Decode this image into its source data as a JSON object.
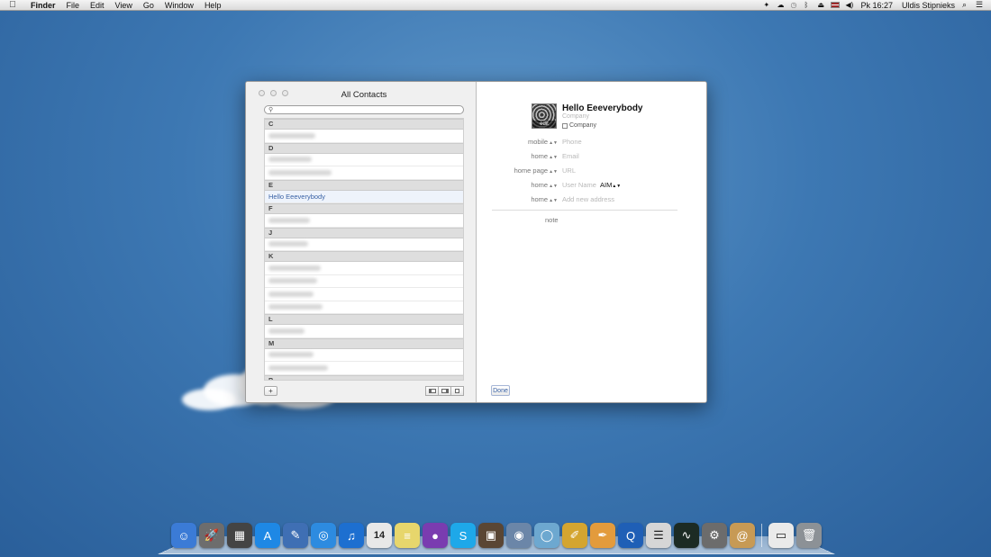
{
  "menubar": {
    "app_name": "Finder",
    "items": [
      "File",
      "Edit",
      "View",
      "Go",
      "Window",
      "Help"
    ],
    "clock": "Pk 16:27",
    "user": "Uldis Stipnieks"
  },
  "window": {
    "title": "All Contacts",
    "sections": [
      {
        "letter": "C",
        "rows": 1
      },
      {
        "letter": "D",
        "rows": 2
      },
      {
        "letter": "E",
        "rows": 0
      },
      {
        "letter": "F",
        "rows": 1
      },
      {
        "letter": "J",
        "rows": 1
      },
      {
        "letter": "K",
        "rows": 4
      },
      {
        "letter": "L",
        "rows": 1
      },
      {
        "letter": "M",
        "rows": 2
      },
      {
        "letter": "P",
        "rows": 0
      }
    ],
    "selected_contact": "Hello Eeeverybody",
    "add_button": "+",
    "card": {
      "name": "Hello Eeeverybody",
      "company_placeholder": "Company",
      "company_checkbox_label": "Company",
      "avatar_edit_label": "edit",
      "fields": [
        {
          "label": "mobile",
          "value": "Phone"
        },
        {
          "label": "home",
          "value": "Email"
        },
        {
          "label": "home page",
          "value": "URL"
        },
        {
          "label": "home",
          "value": "User Name"
        },
        {
          "label": "home",
          "value": "Add new address"
        }
      ],
      "aim_label": "AIM",
      "note_label": "note",
      "done_button": "Done"
    }
  },
  "dock": {
    "icons": [
      {
        "name": "finder-icon",
        "glyph": "☺",
        "color": "#3b7bd6"
      },
      {
        "name": "launchpad-icon",
        "glyph": "🚀",
        "color": "#6d6d6d"
      },
      {
        "name": "mission-control-icon",
        "glyph": "▦",
        "color": "#444"
      },
      {
        "name": "app-store-icon",
        "glyph": "A",
        "color": "#1e88e5"
      },
      {
        "name": "preview-icon",
        "glyph": "✎",
        "color": "#3f6fb4"
      },
      {
        "name": "safari-icon",
        "glyph": "◎",
        "color": "#2d8be0"
      },
      {
        "name": "itunes-icon",
        "glyph": "♫",
        "color": "#1d6fd0"
      },
      {
        "name": "calendar-icon",
        "glyph": "14",
        "color": "#e8e8e8"
      },
      {
        "name": "stickies-icon",
        "glyph": "≡",
        "color": "#e7d66c"
      },
      {
        "name": "chrome-icon",
        "glyph": "●",
        "color": "#7a3cb0"
      },
      {
        "name": "skype-icon",
        "glyph": "S",
        "color": "#1ea8e9"
      },
      {
        "name": "iphoto-icon",
        "glyph": "▣",
        "color": "#5a4634"
      },
      {
        "name": "photo-booth-icon",
        "glyph": "◉",
        "color": "#6b86a8"
      },
      {
        "name": "aperture-icon",
        "glyph": "◯",
        "color": "#6da8d0"
      },
      {
        "name": "pages-icon",
        "glyph": "✐",
        "color": "#d4a530"
      },
      {
        "name": "keynote-icon",
        "glyph": "✒",
        "color": "#e39b3c"
      },
      {
        "name": "quicktime-icon",
        "glyph": "Q",
        "color": "#1f5fb6"
      },
      {
        "name": "textedit-icon",
        "glyph": "☰",
        "color": "#d6d6d6"
      },
      {
        "name": "activity-monitor-icon",
        "glyph": "∿",
        "color": "#1c2b24"
      },
      {
        "name": "system-preferences-icon",
        "glyph": "⚙",
        "color": "#6c6c6c"
      },
      {
        "name": "address-book-icon",
        "glyph": "@",
        "color": "#c79a55"
      },
      {
        "name": "downloads-folder-icon",
        "glyph": "▭",
        "color": "#eaeaea"
      },
      {
        "name": "trash-icon",
        "glyph": "🗑",
        "color": "#8c9196"
      }
    ]
  }
}
